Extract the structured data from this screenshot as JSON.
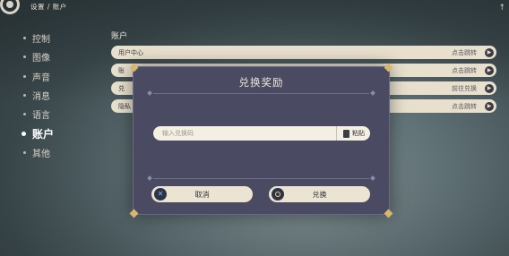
{
  "topbar": {
    "breadcrumb": "设置 / 账户",
    "corner_glyph": "↑"
  },
  "sidebar": {
    "items": [
      {
        "label": "控制",
        "active": false
      },
      {
        "label": "图像",
        "active": false
      },
      {
        "label": "声音",
        "active": false
      },
      {
        "label": "消息",
        "active": false
      },
      {
        "label": "语言",
        "active": false
      },
      {
        "label": "账户",
        "active": true
      },
      {
        "label": "其他",
        "active": false
      }
    ]
  },
  "main": {
    "section_title": "账户",
    "rows": [
      {
        "label": "用户中心",
        "action": "点击跳转"
      },
      {
        "label": "账",
        "action": "点击跳转"
      },
      {
        "label": "兑",
        "action": "前往兑换"
      },
      {
        "label": "隐私",
        "action": "点击跳转"
      }
    ]
  },
  "dialog": {
    "title": "兑换奖励",
    "input_placeholder": "输入兑换码",
    "input_value": "",
    "paste_label": "粘贴",
    "cancel_label": "取消",
    "confirm_label": "兑换"
  },
  "colors": {
    "dialog_bg": "#4a4a63",
    "pill_bg": "#ebe4d2",
    "accent_gold": "#d9b76a"
  }
}
